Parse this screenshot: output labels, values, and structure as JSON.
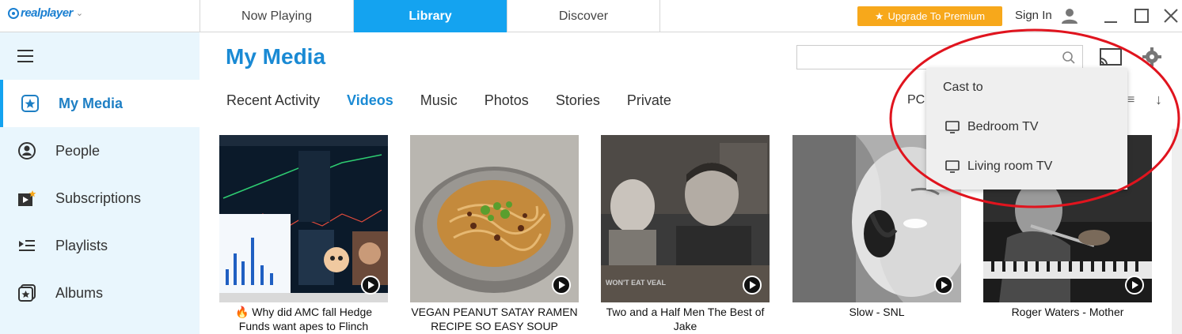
{
  "app": {
    "brand": "realplayer"
  },
  "topbar": {
    "tabs": [
      "Now Playing",
      "Library",
      "Discover"
    ],
    "upgrade_label": "Upgrade To Premium",
    "signin_label": "Sign In"
  },
  "sidebar": {
    "items": [
      {
        "label": "My Media",
        "icon": "star-icon"
      },
      {
        "label": "People",
        "icon": "person-icon"
      },
      {
        "label": "Subscriptions",
        "icon": "subscriptions-icon"
      },
      {
        "label": "Playlists",
        "icon": "playlist-icon"
      },
      {
        "label": "Albums",
        "icon": "album-icon"
      }
    ]
  },
  "main": {
    "title": "My Media",
    "search": {
      "value": "",
      "placeholder": ""
    },
    "subtabs": [
      "Recent Activity",
      "Videos",
      "Music",
      "Photos",
      "Stories",
      "Private"
    ],
    "active_subtab": "Videos",
    "pc_label": "PC",
    "videos": [
      {
        "caption": "🔥 Why did AMC fall  Hedge Funds want apes to Flinch"
      },
      {
        "caption": "VEGAN PEANUT SATAY RAMEN RECIPE   SO EASY SOUP"
      },
      {
        "caption": "Two and a Half Men   The Best of Jake"
      },
      {
        "caption": "Slow - SNL"
      },
      {
        "caption": "Roger Waters - Mother"
      }
    ],
    "thumb_overlay_text": "WON'T EAT VEAL"
  },
  "cast_menu": {
    "title": "Cast to",
    "options": [
      "Bedroom TV",
      "Living room TV"
    ]
  },
  "colors": {
    "accent": "#14a3f0",
    "upgrade": "#f7a81b",
    "annotation": "#e0141e"
  }
}
